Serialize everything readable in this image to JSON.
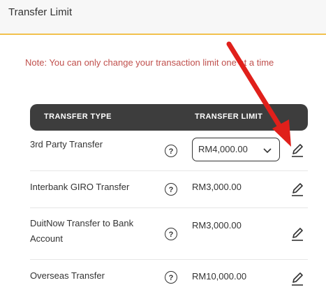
{
  "header": {
    "title": "Transfer Limit"
  },
  "note": "Note: You can only change your transaction limit one at a time",
  "table": {
    "col_type": "TRANSFER TYPE",
    "col_limit": "TRANSFER LIMIT",
    "rows": [
      {
        "type": "3rd Party Transfer",
        "limit": "RM4,000.00",
        "editing": true
      },
      {
        "type": "Interbank GIRO Transfer",
        "limit": "RM3,000.00"
      },
      {
        "type_line1": "DuitNow Transfer to Bank",
        "type_line2": "Account",
        "limit": "RM3,000.00"
      },
      {
        "type": "Overseas Transfer",
        "limit": "RM10,000.00"
      }
    ]
  },
  "help_symbol": "?",
  "colors": {
    "accent": "#f2c14e",
    "note": "#c0504d",
    "header_bg": "#3d3d3d",
    "arrow": "#e0201b"
  },
  "icons": {
    "help": "question-circle-icon",
    "edit": "pencil-icon",
    "dropdown": "chevron-down-icon"
  }
}
